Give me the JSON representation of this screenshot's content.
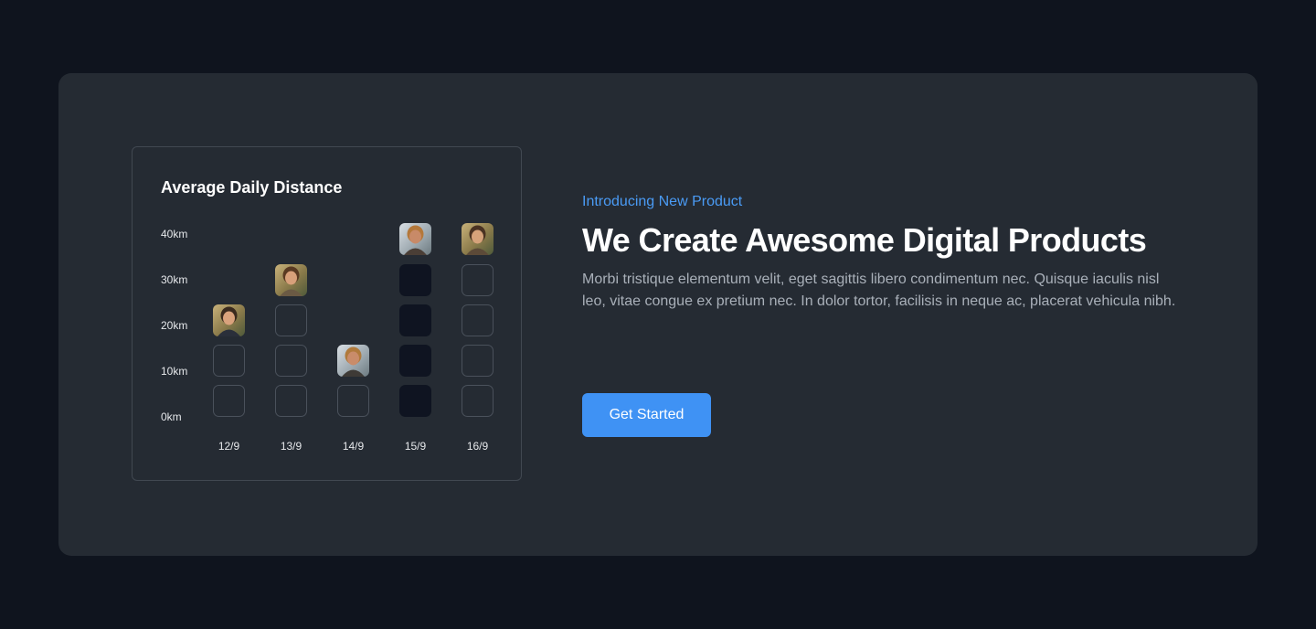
{
  "hero": {
    "eyebrow": "Introducing New Product",
    "headline": "We Create Awesome Digital Products",
    "body": "Morbi tristique elementum velit, eget sagittis libero condimentum nec. Quisque iaculis nisl leo, vitae congue ex pretium nec. In dolor tortor, facilisis in neque ac, placerat vehicula nibh.",
    "cta_label": "Get Started"
  },
  "colors": {
    "background": "#0f141e",
    "card": "#252b33",
    "accent": "#3f92f4",
    "eyebrow": "#4a9bf5",
    "filled_column": "#0f1421"
  },
  "chart_data": {
    "type": "pictograph",
    "title": "Average Daily Distance",
    "categories": [
      "12/9",
      "13/9",
      "14/9",
      "15/9",
      "16/9"
    ],
    "y_ticks": [
      "40km",
      "30km",
      "20km",
      "10km",
      "0km"
    ],
    "ylim": [
      0,
      40
    ],
    "unit": "km",
    "values": [
      20,
      30,
      10,
      40,
      40
    ],
    "highlighted_category": "15/9",
    "marker": "avatar-photo",
    "grid": false
  }
}
